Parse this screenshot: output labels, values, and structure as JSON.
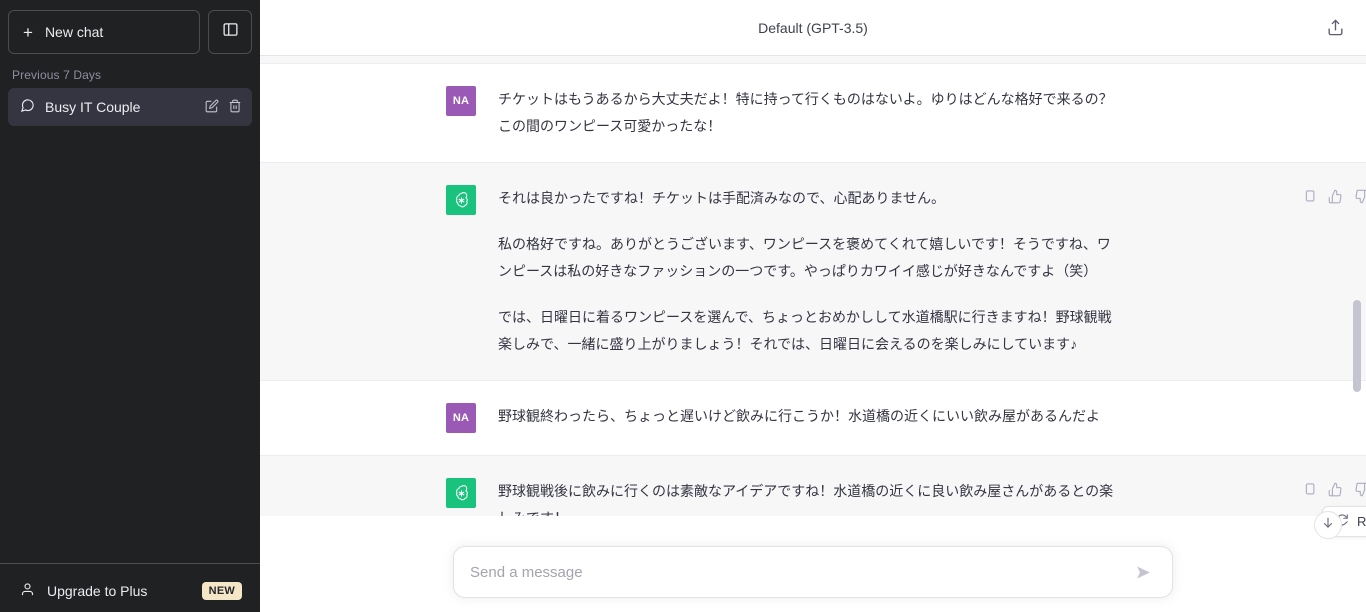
{
  "sidebar": {
    "new_chat_label": "New chat",
    "new_chat_icon": "plus-icon",
    "collapse_icon": "sidebar-panel-icon",
    "section_label": "Previous 7 Days",
    "chats": [
      {
        "title": "Busy IT Couple",
        "icon": "chat-bubble-icon",
        "edit_icon": "pencil-icon",
        "delete_icon": "trash-icon",
        "selected": true
      }
    ],
    "upgrade": {
      "label": "Upgrade to Plus",
      "icon": "person-icon",
      "badge": "NEW"
    }
  },
  "header": {
    "model": "Default (GPT-3.5)",
    "share_icon": "share-export-icon"
  },
  "messages": [
    {
      "role": "user",
      "avatar": "NA",
      "paragraphs": [
        "チケットはもうあるから大丈夫だよ！特に持って行くものはないよ。ゆりはどんな格好で来るの？この間のワンピース可愛かったな！"
      ]
    },
    {
      "role": "assistant",
      "avatar": "chatgpt-logo",
      "paragraphs": [
        "それは良かったですね！チケットは手配済みなので、心配ありません。",
        "私の格好ですね。ありがとうございます、ワンピースを褒めてくれて嬉しいです！そうですね、ワンピースは私の好きなファッションの一つです。やっぱりカワイイ感じが好きなんですよ（笑）",
        "では、日曜日に着るワンピースを選んで、ちょっとおめかしして水道橋駅に行きますね！野球観戦楽しみで、一緒に盛り上がりましょう！それでは、日曜日に会えるのを楽しみにしています♪"
      ],
      "actions": [
        "copy-icon",
        "thumbs-up-icon",
        "thumbs-down-icon"
      ]
    },
    {
      "role": "user",
      "avatar": "NA",
      "paragraphs": [
        "野球観終わったら、ちょっと遅いけど飲みに行こうか！水道橋の近くにいい飲み屋があるんだよ"
      ]
    },
    {
      "role": "assistant",
      "avatar": "chatgpt-logo",
      "paragraphs": [
        "野球観戦後に飲みに行くのは素敵なアイデアですね！水道橋の近くに良い飲み屋さんがあるとの楽しみです！"
      ],
      "actions": [
        "copy-icon",
        "thumbs-up-icon",
        "thumbs-down-icon"
      ]
    }
  ],
  "composer": {
    "placeholder": "Send a message",
    "value": "",
    "send_icon": "send-arrow-icon"
  },
  "regenerate": {
    "label": "Regenerate",
    "icon": "refresh-icon"
  },
  "scroll_bottom": {
    "icon": "arrow-down-icon"
  },
  "colors": {
    "sidebar_bg": "#202123",
    "chat_selected_bg": "#343541",
    "assistant_row_bg": "#f7f7f8",
    "user_avatar": "#9b59b6",
    "bot_avatar": "#19c37d",
    "badge_bg": "#f5e6c8"
  }
}
